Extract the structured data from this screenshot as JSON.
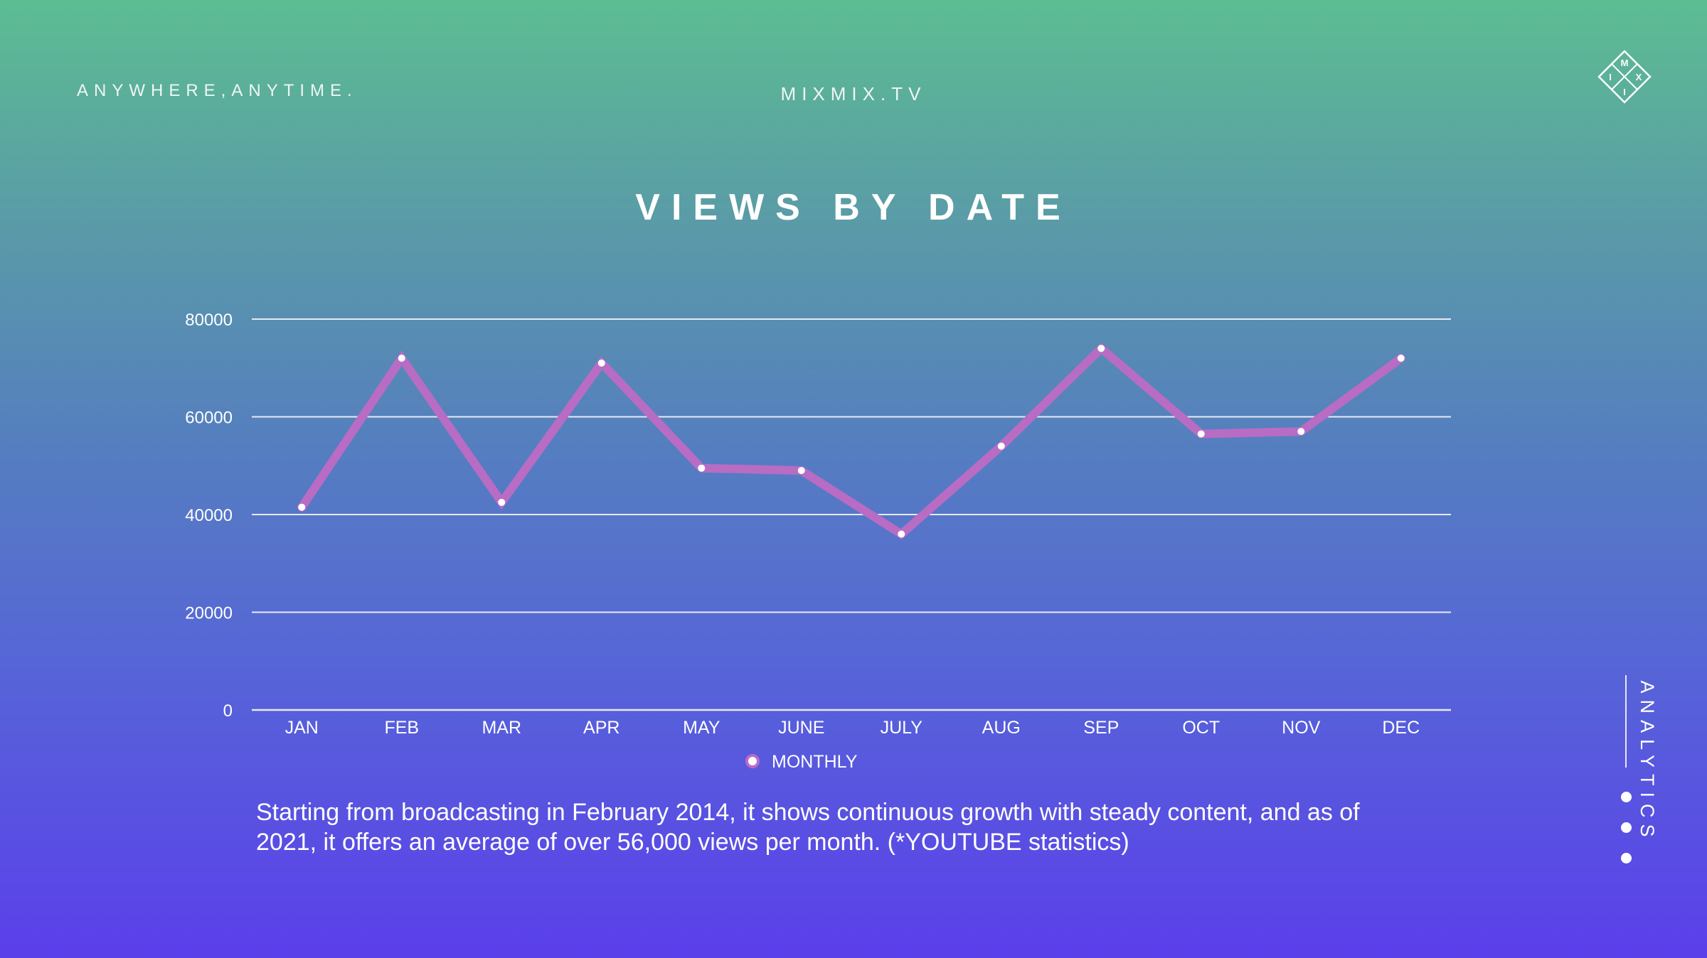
{
  "header": {
    "tagline": "ANYWHERE,ANYTIME.",
    "site": "MIXMIX.TV",
    "logo_letters": [
      "M",
      "I",
      "X",
      "I"
    ]
  },
  "sidebar": {
    "label": "ANALYTICS"
  },
  "description": "Starting from broadcasting in February 2014, it shows continuous growth with steady content, and as of 2021, it offers an average of over 56,000 views per month. (*YOUTUBE statistics)",
  "colors": {
    "line": "#b86cc4",
    "gridline": "#e6eaf4",
    "text": "#ffffff"
  },
  "chart_data": {
    "type": "line",
    "title": "VIEWS BY DATE",
    "xlabel": "",
    "ylabel": "",
    "categories": [
      "JAN",
      "FEB",
      "MAR",
      "APR",
      "MAY",
      "JUNE",
      "JULY",
      "AUG",
      "SEP",
      "OCT",
      "NOV",
      "DEC"
    ],
    "series": [
      {
        "name": "MONTHLY",
        "values": [
          41500,
          72000,
          42500,
          71000,
          49500,
          49000,
          36000,
          54000,
          74000,
          56500,
          57000,
          72000
        ]
      }
    ],
    "ylim": [
      0,
      80000
    ],
    "yticks": [
      0,
      20000,
      40000,
      60000,
      80000
    ],
    "grid": true,
    "legend": "bottom"
  }
}
